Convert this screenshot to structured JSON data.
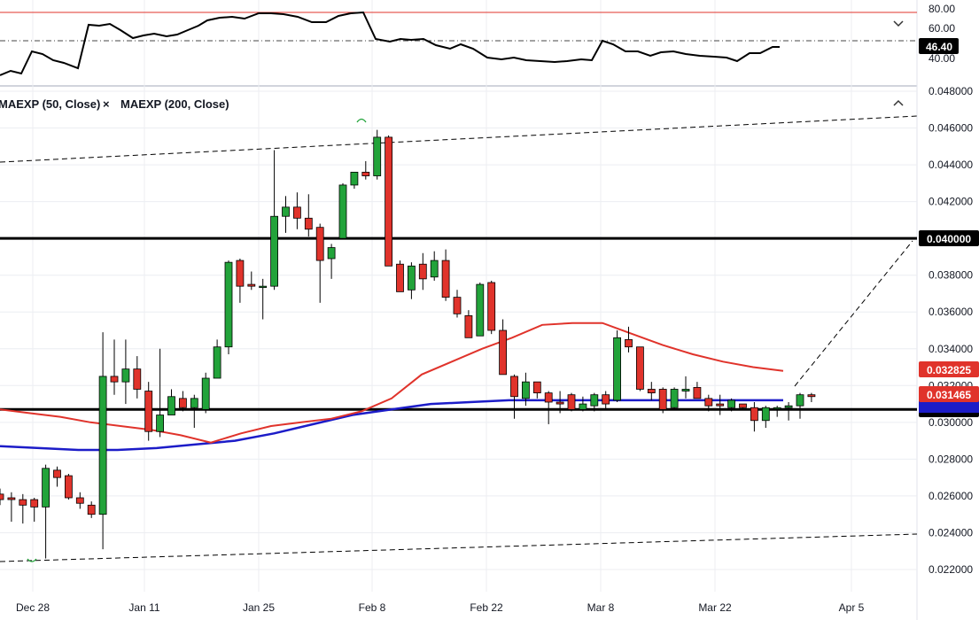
{
  "colors": {
    "up": "#22a33a",
    "down": "#e0332b",
    "ma50": "#e0332b",
    "ma200": "#1c1cc8",
    "grid": "#eceef2",
    "rsi_line": "#000000",
    "rsi_top": "#e0332b"
  },
  "legend": {
    "ma50": "MAEXP (50, Close)",
    "ma200": "MAEXP (200, Close)",
    "close_icon": "×"
  },
  "icons": {
    "collapse": "chevron-up-icon",
    "rsi_collapse": "chevron-down-icon"
  },
  "rsi_panel": {
    "ticks": [
      "80.00",
      "60.00",
      "40.00"
    ],
    "value_label": "46.40"
  },
  "price_tags": {
    "level_040": "0.040000",
    "ma50": "0.032825",
    "ma200": "0.031465"
  },
  "chart_data": {
    "type": "candlestick",
    "x_ticks": [
      "Dec 28",
      "Jan 11",
      "Jan 25",
      "Feb 8",
      "Feb 22",
      "Mar 8",
      "Mar 22",
      "Apr 5"
    ],
    "y_ticks": [
      "0.048000",
      "0.046000",
      "0.044000",
      "0.042000",
      "0.040000",
      "0.038000",
      "0.036000",
      "0.034000",
      "0.032000",
      "0.030000",
      "0.028000",
      "0.026000",
      "0.024000",
      "0.022000"
    ],
    "ylim": [
      0.0215,
      0.0485
    ],
    "horizontal_levels": [
      0.04,
      0.0307
    ],
    "candles": [
      {
        "date": "Dec 24",
        "o": 0.0261,
        "h": 0.0264,
        "l": 0.0255,
        "c": 0.0258
      },
      {
        "date": "Dec 25",
        "o": 0.0259,
        "h": 0.0262,
        "l": 0.0246,
        "c": 0.0258
      },
      {
        "date": "Dec 26",
        "o": 0.0258,
        "h": 0.0261,
        "l": 0.0245,
        "c": 0.0255
      },
      {
        "date": "Dec 27",
        "o": 0.0258,
        "h": 0.0259,
        "l": 0.0246,
        "c": 0.0254
      },
      {
        "date": "Dec 28",
        "o": 0.0254,
        "h": 0.0277,
        "l": 0.0226,
        "c": 0.0275
      },
      {
        "date": "Dec 29",
        "o": 0.0274,
        "h": 0.0276,
        "l": 0.0265,
        "c": 0.027
      },
      {
        "date": "Dec 30",
        "o": 0.0271,
        "h": 0.0272,
        "l": 0.0258,
        "c": 0.0259
      },
      {
        "date": "Dec 31",
        "o": 0.0259,
        "h": 0.0262,
        "l": 0.0253,
        "c": 0.0256
      },
      {
        "date": "Jan 1",
        "o": 0.0255,
        "h": 0.0257,
        "l": 0.0248,
        "c": 0.025
      },
      {
        "date": "Jan 2",
        "o": 0.025,
        "h": 0.0349,
        "l": 0.0231,
        "c": 0.0325
      },
      {
        "date": "Jan 3",
        "o": 0.0325,
        "h": 0.0345,
        "l": 0.0315,
        "c": 0.0322
      },
      {
        "date": "Jan 4",
        "o": 0.0322,
        "h": 0.0345,
        "l": 0.031,
        "c": 0.0329
      },
      {
        "date": "Jan 5",
        "o": 0.0329,
        "h": 0.0336,
        "l": 0.0313,
        "c": 0.0318
      },
      {
        "date": "Jan 6",
        "o": 0.0317,
        "h": 0.0322,
        "l": 0.029,
        "c": 0.0295
      },
      {
        "date": "Jan 7",
        "o": 0.0295,
        "h": 0.034,
        "l": 0.0292,
        "c": 0.0304
      },
      {
        "date": "Jan 8",
        "o": 0.0304,
        "h": 0.0318,
        "l": 0.0304,
        "c": 0.0314
      },
      {
        "date": "Jan 9",
        "o": 0.0313,
        "h": 0.0317,
        "l": 0.0306,
        "c": 0.0308
      },
      {
        "date": "Jan 10",
        "o": 0.0308,
        "h": 0.0315,
        "l": 0.0297,
        "c": 0.0313
      },
      {
        "date": "Jan 11",
        "o": 0.0307,
        "h": 0.0327,
        "l": 0.0305,
        "c": 0.0324
      },
      {
        "date": "Jan 12",
        "o": 0.0324,
        "h": 0.0345,
        "l": 0.0324,
        "c": 0.0341
      },
      {
        "date": "Jan 13",
        "o": 0.0341,
        "h": 0.0388,
        "l": 0.0337,
        "c": 0.0387
      },
      {
        "date": "Jan 14",
        "o": 0.0388,
        "h": 0.0389,
        "l": 0.0365,
        "c": 0.0374
      },
      {
        "date": "Jan 15",
        "o": 0.0375,
        "h": 0.0382,
        "l": 0.0372,
        "c": 0.0374
      },
      {
        "date": "Jan 16",
        "o": 0.0374,
        "h": 0.0378,
        "l": 0.0356,
        "c": 0.0374
      },
      {
        "date": "Jan 17",
        "o": 0.0374,
        "h": 0.0448,
        "l": 0.0372,
        "c": 0.0412
      },
      {
        "date": "Jan 18",
        "o": 0.0412,
        "h": 0.0423,
        "l": 0.0403,
        "c": 0.0417
      },
      {
        "date": "Jan 19",
        "o": 0.0417,
        "h": 0.0425,
        "l": 0.0405,
        "c": 0.0411
      },
      {
        "date": "Jan 20",
        "o": 0.0411,
        "h": 0.0424,
        "l": 0.0401,
        "c": 0.0405
      },
      {
        "date": "Jan 21",
        "o": 0.0406,
        "h": 0.0408,
        "l": 0.0365,
        "c": 0.0388
      },
      {
        "date": "Jan 22",
        "o": 0.0389,
        "h": 0.0397,
        "l": 0.0378,
        "c": 0.0395
      },
      {
        "date": "Jan 23",
        "o": 0.04,
        "h": 0.043,
        "l": 0.04,
        "c": 0.0429
      },
      {
        "date": "Jan 24",
        "o": 0.0429,
        "h": 0.0436,
        "l": 0.0427,
        "c": 0.0436
      },
      {
        "date": "Jan 25",
        "o": 0.0436,
        "h": 0.0442,
        "l": 0.0432,
        "c": 0.0434
      },
      {
        "date": "Jan 26",
        "o": 0.0434,
        "h": 0.0459,
        "l": 0.0432,
        "c": 0.0455
      },
      {
        "date": "Jan 27",
        "o": 0.0455,
        "h": 0.0456,
        "l": 0.0385,
        "c": 0.0385
      },
      {
        "date": "Jan 28",
        "o": 0.0386,
        "h": 0.0388,
        "l": 0.0372,
        "c": 0.0371
      },
      {
        "date": "Jan 29",
        "o": 0.0372,
        "h": 0.0387,
        "l": 0.0367,
        "c": 0.0385
      },
      {
        "date": "Jan 30",
        "o": 0.0386,
        "h": 0.0392,
        "l": 0.0372,
        "c": 0.0378
      },
      {
        "date": "Jan 31",
        "o": 0.0379,
        "h": 0.0393,
        "l": 0.0377,
        "c": 0.0388
      },
      {
        "date": "Feb 1",
        "o": 0.0388,
        "h": 0.0394,
        "l": 0.0366,
        "c": 0.0368
      },
      {
        "date": "Feb 2",
        "o": 0.0368,
        "h": 0.0372,
        "l": 0.0357,
        "c": 0.0359
      },
      {
        "date": "Feb 3",
        "o": 0.0358,
        "h": 0.0361,
        "l": 0.0348,
        "c": 0.0346
      },
      {
        "date": "Feb 4",
        "o": 0.0347,
        "h": 0.0376,
        "l": 0.0347,
        "c": 0.0375
      },
      {
        "date": "Feb 5",
        "o": 0.0376,
        "h": 0.0377,
        "l": 0.0348,
        "c": 0.035
      },
      {
        "date": "Feb 6",
        "o": 0.035,
        "h": 0.0356,
        "l": 0.0347,
        "c": 0.0326
      },
      {
        "date": "Feb 7",
        "o": 0.0325,
        "h": 0.0326,
        "l": 0.0302,
        "c": 0.0314
      },
      {
        "date": "Feb 8",
        "o": 0.0313,
        "h": 0.0327,
        "l": 0.0309,
        "c": 0.0322
      },
      {
        "date": "Feb 9",
        "o": 0.0322,
        "h": 0.0322,
        "l": 0.0313,
        "c": 0.0316
      },
      {
        "date": "Feb 10",
        "o": 0.0316,
        "h": 0.0317,
        "l": 0.0299,
        "c": 0.0311
      },
      {
        "date": "Feb 11",
        "o": 0.0311,
        "h": 0.0317,
        "l": 0.0305,
        "c": 0.031
      },
      {
        "date": "Feb 12",
        "o": 0.0315,
        "h": 0.0316,
        "l": 0.0306,
        "c": 0.0307
      },
      {
        "date": "Feb 13",
        "o": 0.0307,
        "h": 0.0314,
        "l": 0.0306,
        "c": 0.031
      },
      {
        "date": "Feb 14",
        "o": 0.0309,
        "h": 0.0316,
        "l": 0.0306,
        "c": 0.0315
      },
      {
        "date": "Feb 15",
        "o": 0.0315,
        "h": 0.0317,
        "l": 0.0307,
        "c": 0.031
      },
      {
        "date": "Feb 16",
        "o": 0.0312,
        "h": 0.035,
        "l": 0.0311,
        "c": 0.0346
      },
      {
        "date": "Feb 17",
        "o": 0.0345,
        "h": 0.0352,
        "l": 0.0338,
        "c": 0.0341
      },
      {
        "date": "Feb 18",
        "o": 0.0341,
        "h": 0.0341,
        "l": 0.0317,
        "c": 0.0318
      },
      {
        "date": "Feb 19",
        "o": 0.0318,
        "h": 0.0322,
        "l": 0.0312,
        "c": 0.0316
      },
      {
        "date": "Feb 20",
        "o": 0.0318,
        "h": 0.0319,
        "l": 0.0305,
        "c": 0.0307
      },
      {
        "date": "Feb 21",
        "o": 0.0308,
        "h": 0.0319,
        "l": 0.0307,
        "c": 0.0318
      },
      {
        "date": "Feb 22",
        "o": 0.0317,
        "h": 0.0325,
        "l": 0.0313,
        "c": 0.0318
      },
      {
        "date": "Feb 23",
        "o": 0.0319,
        "h": 0.0322,
        "l": 0.0313,
        "c": 0.0313
      },
      {
        "date": "Feb 24",
        "o": 0.0313,
        "h": 0.0315,
        "l": 0.0306,
        "c": 0.0309
      },
      {
        "date": "Feb 25",
        "o": 0.031,
        "h": 0.0315,
        "l": 0.0304,
        "c": 0.0309
      },
      {
        "date": "Feb 26",
        "o": 0.0308,
        "h": 0.0313,
        "l": 0.0306,
        "c": 0.0312
      },
      {
        "date": "Feb 27",
        "o": 0.031,
        "h": 0.031,
        "l": 0.0307,
        "c": 0.0308
      },
      {
        "date": "Feb 28",
        "o": 0.0308,
        "h": 0.0311,
        "l": 0.0295,
        "c": 0.0301
      },
      {
        "date": "Mar 1",
        "o": 0.0301,
        "h": 0.0309,
        "l": 0.0297,
        "c": 0.0308
      },
      {
        "date": "Mar 2",
        "o": 0.0308,
        "h": 0.0309,
        "l": 0.0303,
        "c": 0.0308
      },
      {
        "date": "Mar 3",
        "o": 0.0308,
        "h": 0.0311,
        "l": 0.0301,
        "c": 0.0309
      },
      {
        "date": "Mar 4",
        "o": 0.0309,
        "h": 0.0316,
        "l": 0.0302,
        "c": 0.0315
      },
      {
        "date": "Mar 5",
        "o": 0.0315,
        "h": 0.0316,
        "l": 0.0311,
        "c": 0.0314
      }
    ],
    "ma50": [
      0.0307,
      0.0305,
      0.0303,
      0.03,
      0.0298,
      0.0296,
      0.0293,
      0.0289,
      0.0294,
      0.0298,
      0.03,
      0.0302,
      0.0306,
      0.0313,
      0.0326,
      0.0333,
      0.034,
      0.0346,
      0.0353,
      0.0354,
      0.0354,
      0.0348,
      0.0342,
      0.0337,
      0.0333,
      0.033,
      0.0328
    ],
    "ma200": [
      0.0287,
      0.0286,
      0.0285,
      0.0285,
      0.0286,
      0.0288,
      0.029,
      0.0294,
      0.0299,
      0.0304,
      0.0307,
      0.031,
      0.0311,
      0.0312,
      0.0312,
      0.0312,
      0.0312,
      0.0312,
      0.0312,
      0.0312,
      0.0312
    ]
  }
}
